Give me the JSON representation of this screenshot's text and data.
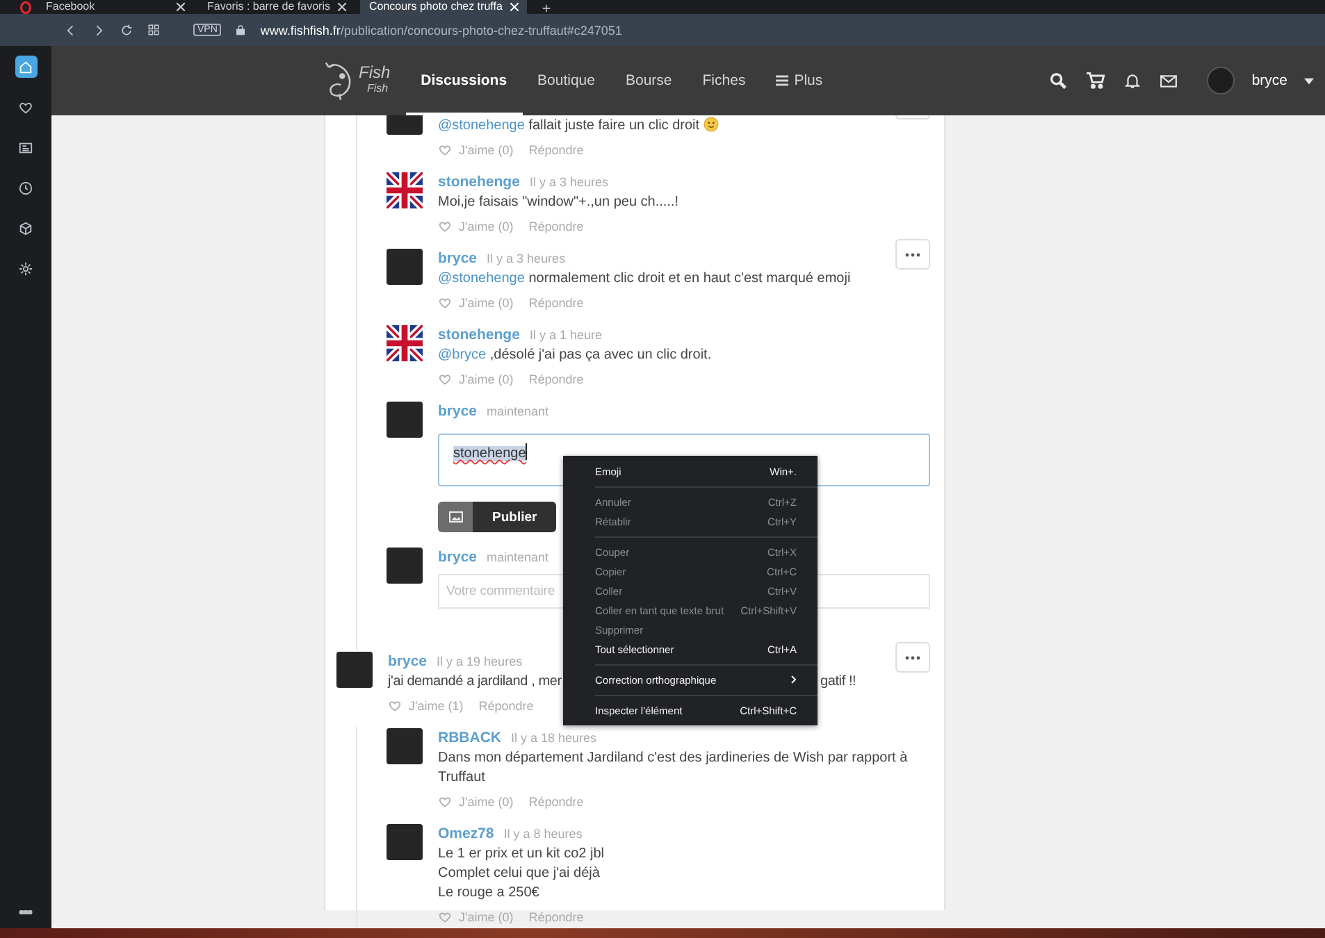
{
  "browser": {
    "tabs": [
      {
        "title": "Facebook",
        "selected": false
      },
      {
        "title": "Favoris : barre de favoris",
        "selected": false
      },
      {
        "title": "Concours photo chez truffa",
        "selected": true
      }
    ],
    "address": {
      "vpn_badge": "VPN",
      "domain": "www.fishfish.fr",
      "path": "/publication/concours-photo-chez-truffaut#c247051"
    },
    "sidebar": [
      {
        "kind": "home",
        "selected": true
      },
      {
        "kind": "heart",
        "selected": false
      },
      {
        "kind": "news",
        "selected": false
      },
      {
        "kind": "clock",
        "selected": false
      },
      {
        "kind": "cube",
        "selected": false
      },
      {
        "kind": "gear",
        "selected": false
      }
    ]
  },
  "site": {
    "logo": {
      "line_1": "Fish",
      "line_2": "Fish"
    },
    "nav": [
      {
        "label": "Discussions",
        "kind": "link",
        "selected": true
      },
      {
        "label": "Boutique",
        "kind": "link",
        "selected": false
      },
      {
        "label": "Bourse",
        "kind": "link",
        "selected": false
      },
      {
        "label": "Fiches",
        "kind": "link",
        "selected": false
      },
      {
        "label": "Plus",
        "kind": "menu",
        "selected": false
      }
    ],
    "user": "bryce"
  },
  "thread": [
    {
      "kind": "replies",
      "items": [
        {
          "kind": "comment",
          "avatar": {
            "kind": "photo"
          },
          "mention": "@stonehenge",
          "lines": [
            "fallait juste faire un clic droit"
          ],
          "emoji": true,
          "likes": "J'aime (0)",
          "reply": "Répondre",
          "has_menu": true
        },
        {
          "kind": "comment",
          "avatar": {
            "kind": "flag"
          },
          "author": "stonehenge",
          "time": "Il y a 3 heures",
          "lines": [
            "Moi,je faisais \"window\"+.,un peu ch.....!"
          ],
          "emoji": false,
          "likes": "J'aime (0)",
          "reply": "Répondre",
          "has_menu": false
        },
        {
          "kind": "comment",
          "avatar": {
            "kind": "photo"
          },
          "author": "bryce",
          "time": "Il y a 3 heures",
          "mention": "@stonehenge",
          "lines": [
            "normalement clic droit et en haut c'est marqué emoji"
          ],
          "emoji": false,
          "likes": "J'aime (0)",
          "reply": "Répondre",
          "has_menu": true
        },
        {
          "kind": "comment",
          "avatar": {
            "kind": "flag"
          },
          "author": "stonehenge",
          "time": "Il y a 1 heure",
          "mention": "@bryce",
          "lines": [
            ",désolé j'ai pas ça avec un clic droit."
          ],
          "emoji": false,
          "likes": "J'aime (0)",
          "reply": "Répondre",
          "has_menu": false
        },
        {
          "kind": "composer",
          "avatar": {
            "kind": "photo"
          },
          "author": "bryce",
          "time": "maintenant",
          "value": "stonehenge",
          "value_selected": true,
          "misspelled": true,
          "button": "Publier"
        },
        {
          "kind": "input",
          "avatar": {
            "kind": "photo"
          },
          "author": "bryce",
          "time": "maintenant",
          "placeholder": "Votre commentaire"
        }
      ]
    },
    {
      "kind": "comment",
      "avatar": {
        "kind": "photo"
      },
      "author": "bryce",
      "time": "Il y a 19 heures",
      "lines": [
        "j'ai demandé a jardiland , mer"
      ],
      "text_after_menu": "gatif !!",
      "emoji": false,
      "likes": "J'aime (1)",
      "reply": "Répondre",
      "has_menu": true
    },
    {
      "kind": "replies",
      "items": [
        {
          "kind": "comment",
          "avatar": {
            "kind": "photo"
          },
          "author": "RBBACK",
          "time": "Il y a 18 heures",
          "lines": [
            "Dans mon département Jardiland c'est des jardineries de Wish par rapport à Truffaut"
          ],
          "emoji": false,
          "likes": "J'aime (0)",
          "reply": "Répondre",
          "has_menu": false
        },
        {
          "kind": "comment",
          "avatar": {
            "kind": "photo"
          },
          "author": "Omez78",
          "time": "Il y a 8 heures",
          "lines": [
            "Le 1 er prix et un kit co2 jbl",
            "Complet celui que j'ai déjà",
            "Le rouge a 250€"
          ],
          "emoji": false,
          "likes": "J'aime (0)",
          "reply": "Répondre",
          "has_menu": false
        }
      ]
    }
  ],
  "context_menu": [
    {
      "kind": "item",
      "label": "Emoji",
      "shortcut": "Win+.",
      "disabled": false
    },
    {
      "kind": "separator"
    },
    {
      "kind": "item",
      "label": "Annuler",
      "shortcut": "Ctrl+Z",
      "disabled": true
    },
    {
      "kind": "item",
      "label": "Rétablir",
      "shortcut": "Ctrl+Y",
      "disabled": true
    },
    {
      "kind": "separator"
    },
    {
      "kind": "item",
      "label": "Couper",
      "shortcut": "Ctrl+X",
      "disabled": true
    },
    {
      "kind": "item",
      "label": "Copier",
      "shortcut": "Ctrl+C",
      "disabled": true
    },
    {
      "kind": "item",
      "label": "Coller",
      "shortcut": "Ctrl+V",
      "disabled": true
    },
    {
      "kind": "item",
      "label": "Coller en tant que texte brut",
      "shortcut": "Ctrl+Shift+V",
      "disabled": true
    },
    {
      "kind": "item",
      "label": "Supprimer",
      "disabled": true
    },
    {
      "kind": "item",
      "label": "Tout sélectionner",
      "shortcut": "Ctrl+A",
      "disabled": false
    },
    {
      "kind": "separator"
    },
    {
      "kind": "item",
      "label": "Correction orthographique",
      "submenu": true,
      "disabled": false
    },
    {
      "kind": "separator"
    },
    {
      "kind": "item",
      "label": "Inspecter l'élément",
      "shortcut": "Ctrl+Shift+C",
      "disabled": false
    }
  ]
}
